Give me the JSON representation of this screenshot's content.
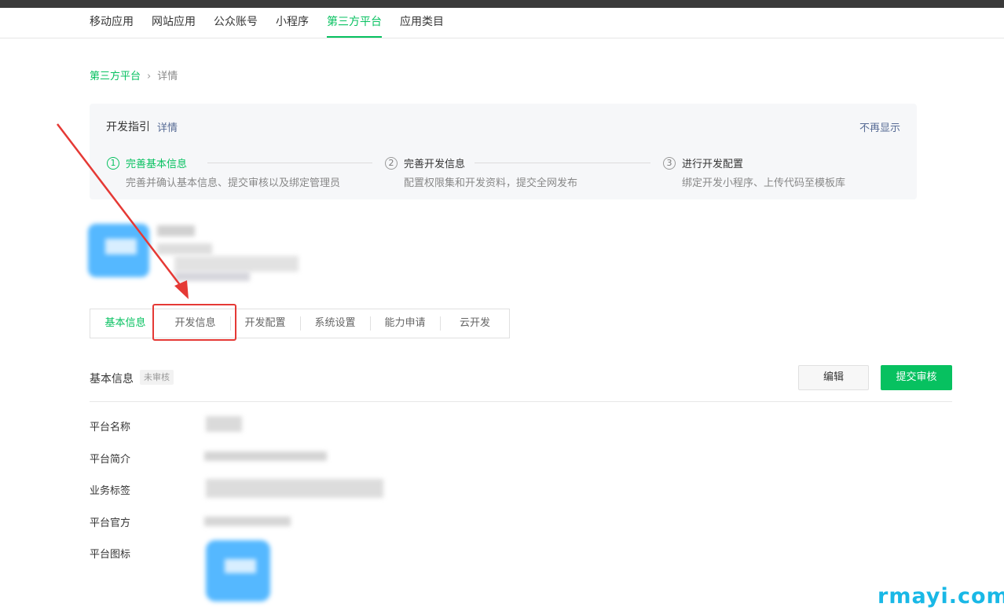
{
  "nav": {
    "items": [
      {
        "label": "移动应用",
        "active": false
      },
      {
        "label": "网站应用",
        "active": false
      },
      {
        "label": "公众账号",
        "active": false
      },
      {
        "label": "小程序",
        "active": false
      },
      {
        "label": "第三方平台",
        "active": true
      },
      {
        "label": "应用类目",
        "active": false
      }
    ]
  },
  "breadcrumb": {
    "parent": "第三方平台",
    "separator": "›",
    "current": "详情"
  },
  "guide": {
    "title": "开发指引",
    "detail_link": "详情",
    "hide_label": "不再显示",
    "steps": [
      {
        "num": "1",
        "title": "完善基本信息",
        "desc": "完善并确认基本信息、提交审核以及绑定管理员",
        "active": true
      },
      {
        "num": "2",
        "title": "完善开发信息",
        "desc": "配置权限集和开发资料，提交全网发布",
        "active": false
      },
      {
        "num": "3",
        "title": "进行开发配置",
        "desc": "绑定开发小程序、上传代码至模板库",
        "active": false
      }
    ]
  },
  "tabs": [
    {
      "label": "基本信息",
      "active": true
    },
    {
      "label": "开发信息",
      "active": false
    },
    {
      "label": "开发配置",
      "active": false
    },
    {
      "label": "系统设置",
      "active": false
    },
    {
      "label": "能力申请",
      "active": false
    },
    {
      "label": "云开发",
      "active": false
    }
  ],
  "section": {
    "title": "基本信息",
    "badge": "未审核",
    "edit_label": "编辑",
    "submit_label": "提交审核"
  },
  "fields": [
    {
      "label": "平台名称"
    },
    {
      "label": "平台简介"
    },
    {
      "label": "业务标签"
    },
    {
      "label": "平台官方"
    },
    {
      "label": "平台图标"
    }
  ],
  "colors": {
    "accent": "#07c160",
    "link": "#576b95",
    "annotation": "#e53935",
    "watermark": "#19b8e6"
  },
  "watermark": "rmayi.com"
}
